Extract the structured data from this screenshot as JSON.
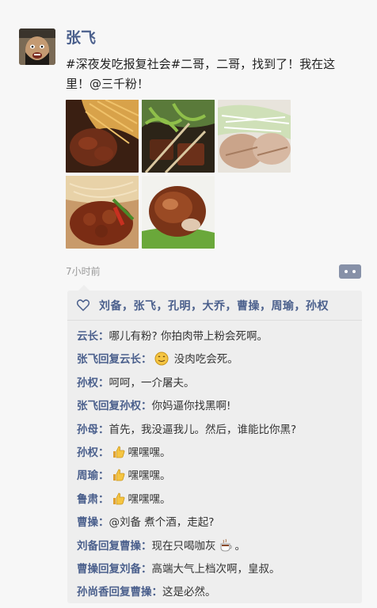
{
  "post": {
    "author": "张飞",
    "content": "#深夜发吃报复社会#二哥，二哥，找到了！我在这里！@三千粉！",
    "time": "7小时前"
  },
  "likes": {
    "names": "刘备，张飞，孔明，大乔，曹操，周瑜，孙权"
  },
  "comments": [
    {
      "author": "云长：",
      "text": "哪儿有粉? 你拍肉带上粉会死啊。",
      "emoji": ""
    },
    {
      "author": "张飞回复云长：",
      "text": " 没肉吃会死。",
      "emoji": "smile"
    },
    {
      "author": "孙权：",
      "text": "呵呵，一介屠夫。",
      "emoji": ""
    },
    {
      "author": "张飞回复孙权：",
      "text": "你妈逼你找黑啊!",
      "emoji": ""
    },
    {
      "author": "孙母：",
      "text": "首先，我没逼我儿。然后，谁能比你黑?",
      "emoji": ""
    },
    {
      "author": "孙权：",
      "text": "嘿嘿嘿。",
      "emoji": "thumb"
    },
    {
      "author": "周瑜：",
      "text": "嘿嘿嘿。",
      "emoji": "thumb"
    },
    {
      "author": "鲁肃：",
      "text": "嘿嘿嘿。",
      "emoji": "thumb"
    },
    {
      "author": "曹操：",
      "text": "@刘备 煮个酒，走起?",
      "emoji": ""
    },
    {
      "author": "刘备回复曹操：",
      "text": "现在只喝咖灰",
      "emoji": "coffee"
    },
    {
      "author": "曹操回复刘备：",
      "text": "高端大气上档次啊，皇叔。",
      "emoji": ""
    },
    {
      "author": "孙尚香回复曹操：",
      "text": "这是必然。",
      "emoji": ""
    }
  ],
  "colors": {
    "name_blue": "#4a5f8c",
    "panel_bg": "#eeeeee",
    "time_gray": "#9a9a9a"
  },
  "icons": {
    "like": "heart-outline-icon",
    "more": "more-options-icon"
  }
}
